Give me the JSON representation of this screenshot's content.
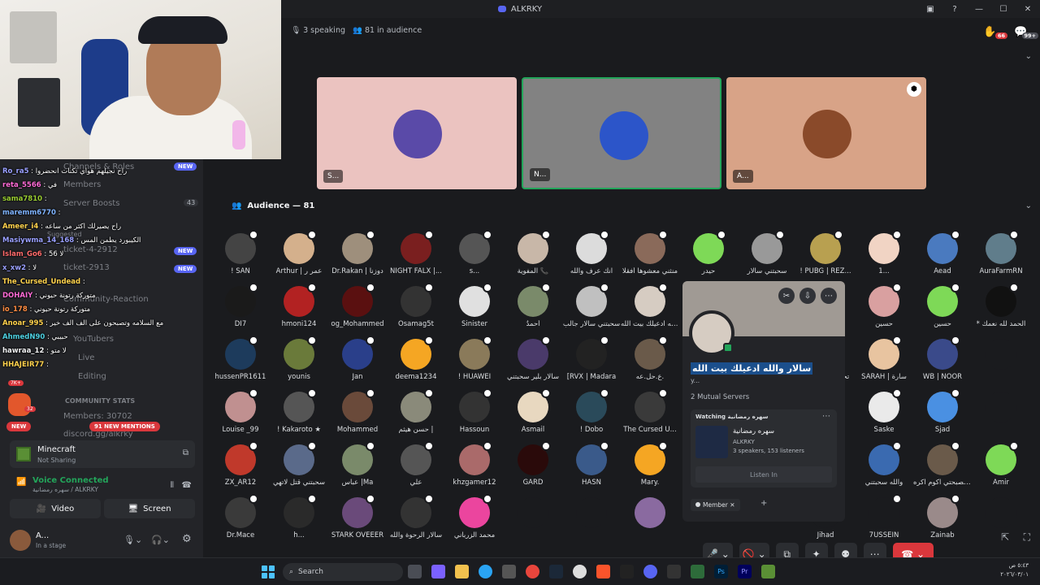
{
  "window": {
    "title": "ALKRKY"
  },
  "stage": {
    "speaking": "3 speaking",
    "audience_count": "81 in audience",
    "notif_count": "66",
    "inbox_count": "99+"
  },
  "speakers": [
    {
      "label": "S...",
      "bg": "#ebc3c0",
      "avatar": "#5a4aa8"
    },
    {
      "label": "N...",
      "bg": "#828282",
      "avatar": "#2c55c9"
    },
    {
      "label": "A...",
      "bg": "#d8a387",
      "avatar": "#8a4a2a"
    }
  ],
  "audience_header": "Audience — 81",
  "audience_rows": [
    [
      {
        "n": "! SAN",
        "c": "#444"
      },
      {
        "n": "Arthur | عمر ر",
        "c": "#d4b08c"
      },
      {
        "n": "Dr.Rakan | دوزنا",
        "c": "#9e8f7c"
      },
      {
        "n": "NIGHT FALX |...",
        "c": "#7a1f1f"
      },
      {
        "n": "s...",
        "c": "#555"
      },
      {
        "n": "المفوية 📞",
        "c": "#c8b7a8"
      },
      {
        "n": "انك عرف والله",
        "c": "#dcdcdc"
      },
      {
        "n": "منثني معشوها أفقلا",
        "c": "#8a6a5a"
      },
      {
        "n": "حيدر",
        "c": "#7ed957"
      },
      {
        "n": "سحبتني سالار",
        "c": "#999"
      },
      {
        "n": "! PUBG | REZ...",
        "c": "#b8a050"
      },
      {
        "n": "1...",
        "c": "#f1d4c4"
      },
      {
        "n": "Aead",
        "c": "#4a7abf"
      },
      {
        "n": "AuraFarmRN",
        "c": "#607d8b"
      }
    ],
    [
      {
        "n": "DI7",
        "c": "#1a1a1a"
      },
      {
        "n": "hmoni124",
        "c": "#b22222"
      },
      {
        "n": "og_Mohammed",
        "c": "#5a1010"
      },
      {
        "n": "Osamag5t",
        "c": "#333"
      },
      {
        "n": "Sinister",
        "c": "#e0e0e0"
      },
      {
        "n": "أحمدُ",
        "c": "#7a8a6a"
      },
      {
        "n": "سحبتني سالار جالب",
        "c": "#c0c0c0"
      },
      {
        "n": "والله ادعيلك بيت الله",
        "c": "#d6ccc2"
      },
      {
        "n": "",
        "c": "#232428"
      },
      {
        "n": "",
        "c": "#232428"
      },
      {
        "n": "MALAK ❤️‍🩹",
        "c": "#2a2a2a"
      },
      {
        "n": "حسين",
        "c": "#d9a0a0"
      },
      {
        "n": "حسين",
        "c": "#7ed957"
      },
      {
        "n": "* الحمد لله نعمك",
        "c": "#111"
      }
    ],
    [
      {
        "n": "hussenPR1611",
        "c": "#1d3b5c"
      },
      {
        "n": "younis",
        "c": "#6a7a3a"
      },
      {
        "n": "Jan",
        "c": "#2a3f8a"
      },
      {
        "n": "deema1234",
        "c": "#f5a623"
      },
      {
        "n": "! HUAWEI",
        "c": "#8a7a5a"
      },
      {
        "n": "سالار بلير سحبتني",
        "c": "#4a3a6a"
      },
      {
        "n": "[RVX | Madara",
        "c": "#222"
      },
      {
        "n": "ع.حل.عه.",
        "c": "#6a5a4a"
      },
      {
        "n": "",
        "c": "#232428"
      },
      {
        "n": "",
        "c": "#232428"
      },
      {
        "n": "تحدي سوال مهم",
        "c": "#888"
      },
      {
        "n": "SARAH | سارة",
        "c": "#e8c4a0"
      },
      {
        "n": "WB | NOOR",
        "c": "#3a4a8a"
      },
      {
        "n": "",
        "c": "#1a1b1e"
      }
    ],
    [
      {
        "n": "Louise _99",
        "c": "#c09090"
      },
      {
        "n": "! Kakaroto ★",
        "c": "#555"
      },
      {
        "n": "Mohammed",
        "c": "#6a4a3a"
      },
      {
        "n": "حسن هيثم |",
        "c": "#8a8a7a"
      },
      {
        "n": "Hassoun",
        "c": "#333"
      },
      {
        "n": "Asmail",
        "c": "#e8d8c0"
      },
      {
        "n": "! Dobo",
        "c": "#2a4a5a"
      },
      {
        "n": "The Cursed U...",
        "c": "#3a3a3a"
      },
      {
        "n": "",
        "c": "#232428"
      },
      {
        "n": "",
        "c": "#232428"
      },
      {
        "n": "Iman",
        "c": "#b0a090"
      },
      {
        "n": "Saske",
        "c": "#eaeaea"
      },
      {
        "n": "Sjad",
        "c": "#4a90e2"
      },
      {
        "n": "",
        "c": "#1a1b1e"
      }
    ],
    [
      {
        "n": "ZX_AR12",
        "c": "#c0392b"
      },
      {
        "n": "سحبتني قتل لاتهي",
        "c": "#5a6a8a"
      },
      {
        "n": "عباس |Ma",
        "c": "#7a8a6a"
      },
      {
        "n": "علي",
        "c": "#555"
      },
      {
        "n": "khzgamer12",
        "c": "#aa6a6a"
      },
      {
        "n": "GARD",
        "c": "#2a0a0a"
      },
      {
        "n": "HASN",
        "c": "#3a5a8a"
      },
      {
        "n": "Mary.",
        "c": "#f5a623"
      },
      {
        "n": "",
        "c": "#232428"
      },
      {
        "n": "",
        "c": "#232428"
      },
      {
        "n": "",
        "c": "#1a1b1e"
      },
      {
        "n": "والله سحبتني",
        "c": "#3a6ab0"
      },
      {
        "n": "اذا تصبحتي اكوم اكره",
        "c": "#6a5a4a"
      },
      {
        "n": "Amir",
        "c": "#7ed957"
      }
    ],
    [
      {
        "n": "Dr.Mace",
        "c": "#3a3a3a"
      },
      {
        "n": "h...",
        "c": "#2a2a2a"
      },
      {
        "n": "STARK OVEEER",
        "c": "#6a4a7a"
      },
      {
        "n": "سالار الرحوة والله",
        "c": "#333"
      },
      {
        "n": "محمد الزرباني",
        "c": "#eb459e"
      },
      {
        "n": "",
        "c": "#1a1b1e"
      },
      {
        "n": "",
        "c": "#1a1b1e"
      },
      {
        "n": "",
        "c": "#8a6aa0"
      },
      {
        "n": "",
        "c": "#232428"
      },
      {
        "n": "",
        "c": "#232428"
      },
      {
        "n": "Jihad",
        "c": "#1a1b1e"
      },
      {
        "n": "7USSEIN",
        "c": "#1a1b1e"
      },
      {
        "n": "Zainab",
        "c": "#9a8a8a"
      },
      {
        "n": "",
        "c": "#1a1b1e"
      }
    ]
  ],
  "popup": {
    "name": "سالار والله ادعيلك بيت الله",
    "tag": "y...",
    "mutual": "2 Mutual Servers",
    "watching_label": "Watching سهره رمضانية",
    "card_title": "سهره رمضانية",
    "card_server": "ALKRKY",
    "card_stats": "3 speakers, 153 listeners",
    "listen_label": "Listen In",
    "role": "Member"
  },
  "sidebar": {
    "items": [
      "Channels & Roles",
      "Members",
      "Server Boosts",
      "Suggested",
      "ticket-4-2912",
      "ticket-2913",
      "Community-Reaction",
      "YouTubers",
      "Live",
      "Editing",
      "COMMUNITY STATS",
      "Members: 30702",
      "discord.gg/alkrky"
    ],
    "boost_count": "43",
    "new_label": "NEW",
    "mentions_label": "91 NEW MENTIONS",
    "server_badge": "32",
    "server_badge2": "7K+"
  },
  "chat": [
    {
      "u": "Ro_ra5",
      "m": "راح نجيلهم هواي تكنات انحضروا",
      "c": "#9aa0ff"
    },
    {
      "u": "reta_5566",
      "m": "في",
      "c": "#ff6bd6"
    },
    {
      "u": "sama7810",
      "m": "",
      "c": "#9acd32"
    },
    {
      "u": "maremm6770",
      "m": "",
      "c": "#7fb3ff"
    },
    {
      "u": "Ameer_i4",
      "m": "راح يصيرلك اكثر من ساعه",
      "c": "#ffd24d"
    },
    {
      "u": "Masiywma_14_168",
      "m": "الكيبورد يطمن المس",
      "c": "#9aa0ff"
    },
    {
      "u": "Islam_Go6",
      "m": "56 لا",
      "c": "#ff6b6b"
    },
    {
      "u": "x_xw2",
      "m": "لا",
      "c": "#9aa0ff"
    },
    {
      "u": "The_Cursed_Undead",
      "m": "",
      "c": "#ffd24d"
    },
    {
      "u": "DOHAIY",
      "m": "متوركة رتونة حيوني",
      "c": "#ff6bd6"
    },
    {
      "u": "io_178",
      "m": "متوركة رتونة حيوني",
      "c": "#ff8c42"
    },
    {
      "u": "Anoar_995",
      "m": "مع السلامه وتصبحون على الف الف خير",
      "c": "#ffd24d"
    },
    {
      "u": "AhmedN90",
      "m": "حبيبي",
      "c": "#4dd0e1"
    },
    {
      "u": "hawraa_12",
      "m": "لا متو",
      "c": "#f2f3f5"
    },
    {
      "u": "HHAJEIR77",
      "m": "",
      "c": "#ffd24d"
    }
  ],
  "voice": {
    "game": "Minecraft",
    "game_sub": "Not Sharing",
    "connected": "Voice Connected",
    "channel": "سهره رمضانية / ALKRKY",
    "video_label": "Video",
    "screen_label": "Screen",
    "user_name": "A...",
    "user_status": "In a stage"
  },
  "taskbar": {
    "search_placeholder": "Search",
    "date": "٢٠٢٦/٠٣/٠١",
    "time": "٥:٤٣ ص"
  }
}
